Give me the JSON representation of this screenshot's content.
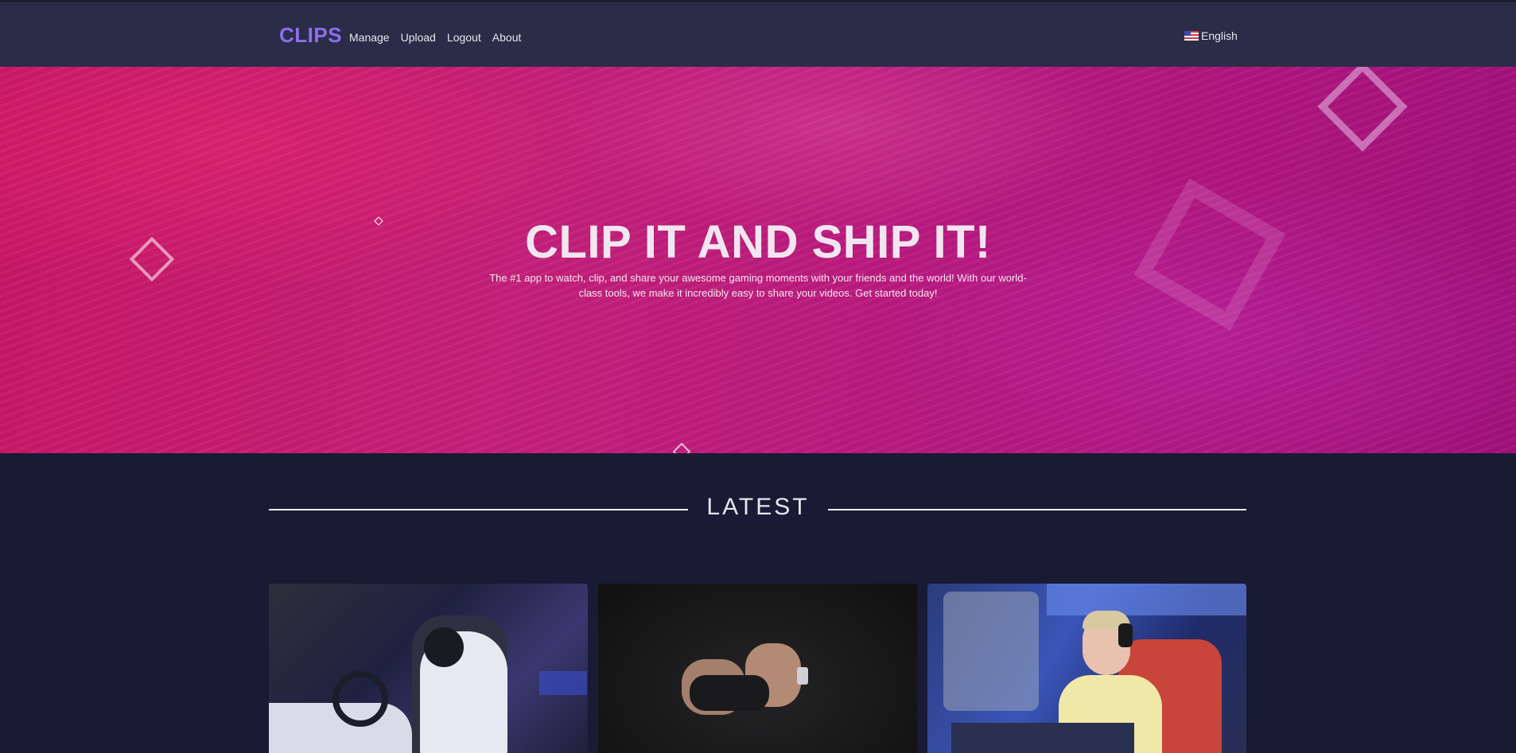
{
  "navbar": {
    "brand": "CLIPS",
    "links": [
      "Manage",
      "Upload",
      "Logout",
      "About"
    ],
    "language": "English"
  },
  "hero": {
    "title": "CLIP IT AND SHIP IT!",
    "text": "The #1 app to watch, clip, and share your awesome gaming moments with your friends and the world! With our world-class tools, we make it incredibly easy to share your videos. Get started today!"
  },
  "latest": {
    "title": "LATEST"
  },
  "colors": {
    "brand": "#8c6ff2",
    "navbar": "#2b2d48",
    "background": "#191a33",
    "hero_primary": "#c5207a"
  }
}
